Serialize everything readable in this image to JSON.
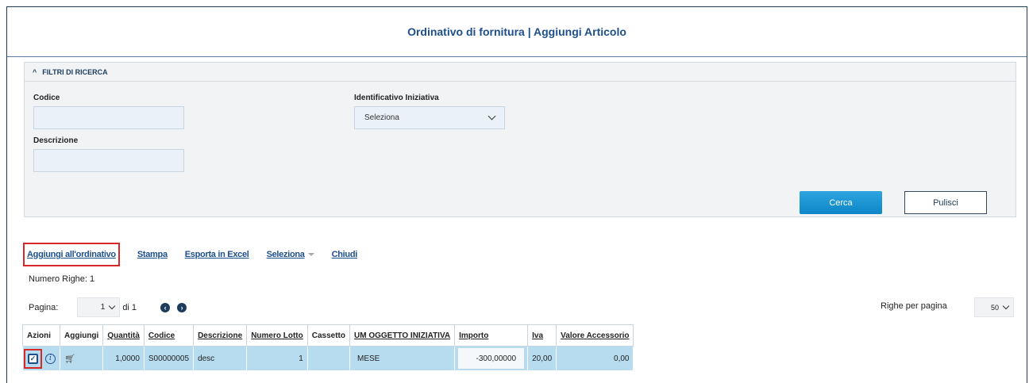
{
  "header": {
    "title": "Ordinativo di fornitura | Aggiungi Articolo"
  },
  "filters": {
    "section_title": "FILTRI DI RICERCA",
    "codice_label": "Codice",
    "codice_value": "",
    "descrizione_label": "Descrizione",
    "descrizione_value": "",
    "iniziativa_label": "Identificativo Iniziativa",
    "iniziativa_value": "Seleziona",
    "search_label": "Cerca",
    "clear_label": "Pulisci"
  },
  "actions": {
    "add": "Aggiungi all'ordinativo",
    "print": "Stampa",
    "export": "Esporta in Excel",
    "select": "Seleziona",
    "close": "Chiudi"
  },
  "results": {
    "rows_count": "Numero Righe: 1",
    "page_label": "Pagina:",
    "page_value": "1",
    "page_total": "di 1",
    "per_page_label": "Righe per pagina",
    "per_page_value": "50"
  },
  "table": {
    "headers": [
      "Azioni",
      "Aggiungi",
      "Quantità",
      "Codice",
      "Descrizione",
      "Numero Lotto",
      "Cassetto",
      "UM OGGETTO INIZIATIVA",
      "Importo",
      "Iva",
      "Valore Accessorio"
    ],
    "row": {
      "quantita": "1,0000",
      "codice": "S00000005",
      "descrizione": "desc",
      "numero_lotto": "1",
      "cassetto": "",
      "um": "MESE",
      "importo": "-300,00000",
      "iva": "20,00",
      "valore_accessorio": "0,00"
    }
  },
  "colors": {
    "accent": "#0e86c8",
    "title": "#1d4f8c",
    "row_bg": "#b8dcef",
    "highlight": "#d62828"
  }
}
